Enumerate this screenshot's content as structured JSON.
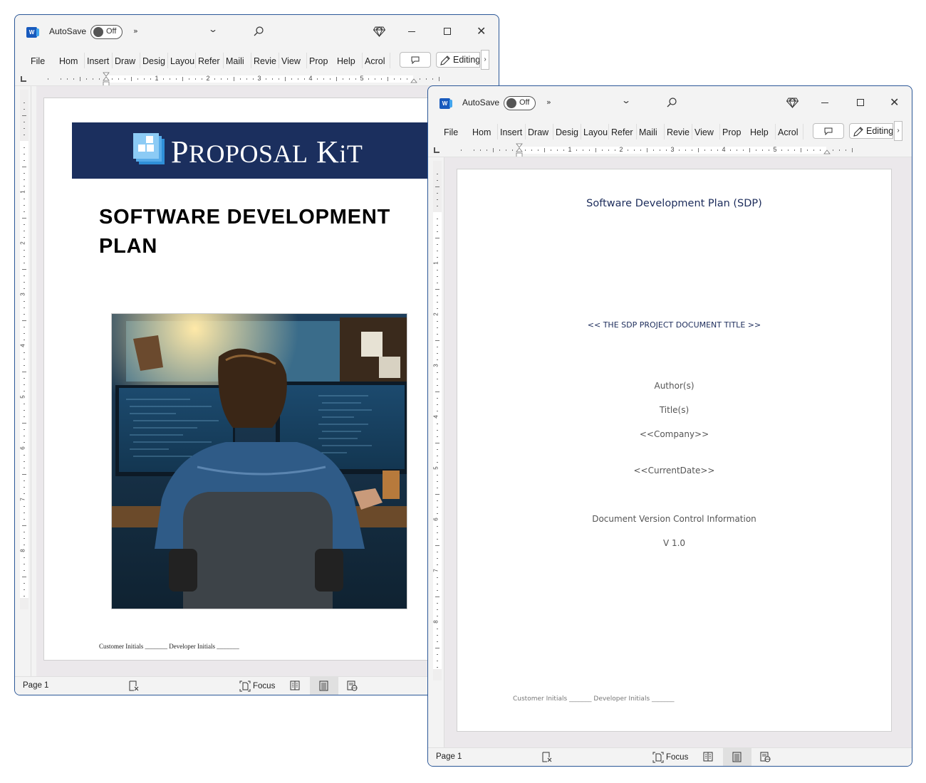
{
  "windows": [
    {
      "id": "left",
      "app": "Word",
      "autosave": {
        "label": "AutoSave",
        "state": "Off"
      },
      "ribbon_tabs": [
        "File",
        "Hom",
        "Insert",
        "Draw",
        "Desig",
        "Layou",
        "Refer",
        "Maili",
        "Revie",
        "View",
        "Prop",
        "Help",
        "Acrol"
      ],
      "editing_label": "Editing",
      "ruler_numbers": [
        "1",
        "2",
        "3",
        "4",
        "5"
      ],
      "vruler_numbers": [
        "1",
        "2",
        "3",
        "4",
        "5",
        "6",
        "7",
        "8"
      ],
      "status": {
        "page": "Page 1",
        "focus": "Focus"
      },
      "document": {
        "logo_text": "Proposal Kit",
        "logo_parts": {
          "p": "P",
          "roposal": "ROPOSAL",
          "k": "K",
          "i": "i",
          "t": "T"
        },
        "title_line1": "SOFTWARE DEVELOPMENT",
        "title_line2": "PLAN",
        "photo_alt": "Developer working at dual monitors with code",
        "initials": "Customer Initials  _______ Developer Initials _______"
      }
    },
    {
      "id": "right",
      "app": "Word",
      "autosave": {
        "label": "AutoSave",
        "state": "Off"
      },
      "ribbon_tabs": [
        "File",
        "Hom",
        "Insert",
        "Draw",
        "Desig",
        "Layou",
        "Refer",
        "Maili",
        "Revie",
        "View",
        "Prop",
        "Help",
        "Acrol"
      ],
      "editing_label": "Editing",
      "ruler_numbers": [
        "1",
        "2",
        "3",
        "4",
        "5"
      ],
      "vruler_numbers": [
        "1",
        "2",
        "3",
        "4",
        "5",
        "6",
        "7",
        "8"
      ],
      "status": {
        "page": "Page 1",
        "focus": "Focus"
      },
      "document": {
        "heading": "Software Development Plan (SDP)",
        "doc_title": "<< THE SDP PROJECT DOCUMENT TITLE >>",
        "authors": "Author(s)",
        "titles": "Title(s)",
        "company": "<<Company>>",
        "date": "<<CurrentDate>>",
        "version_info": "Document Version Control Information",
        "version": "V 1.0",
        "initials": "Customer Initials  _______ Developer Initials _______"
      }
    }
  ],
  "colors": {
    "window_border": "#2b5797",
    "word_blue": "#185abd",
    "banner_navy": "#1b2f5e",
    "heading_navy": "#1c2c5b",
    "doc_bg": "#ebe8eb"
  }
}
